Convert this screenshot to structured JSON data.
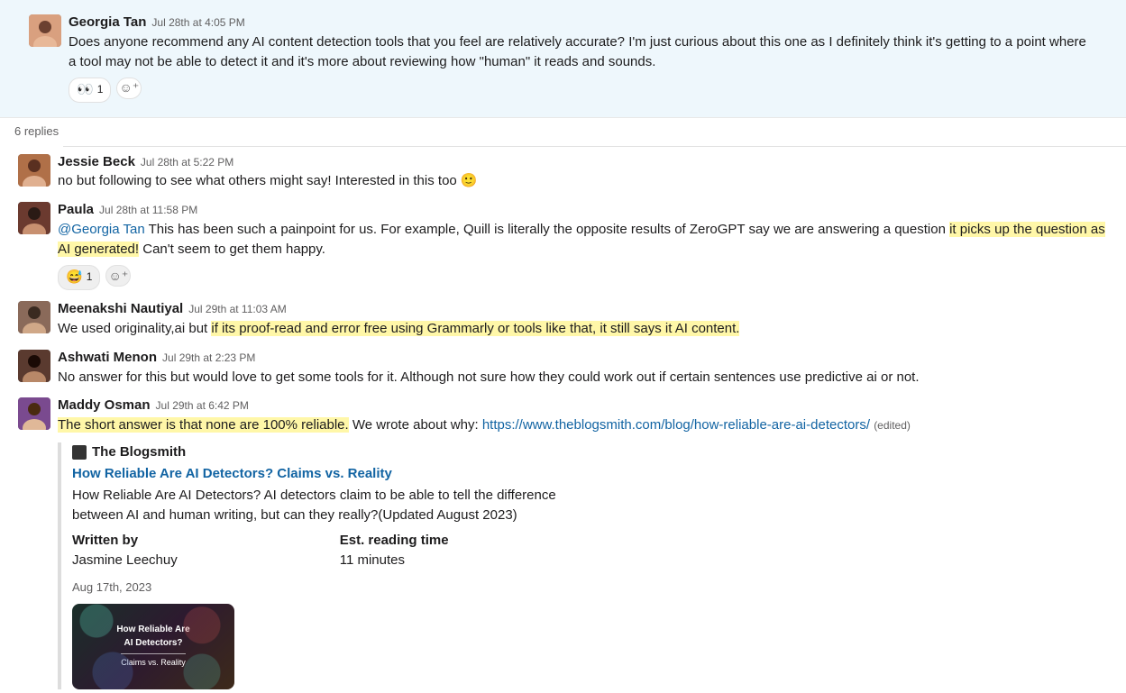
{
  "root": {
    "author": "Georgia Tan",
    "timestamp": "Jul 28th at 4:05 PM",
    "text": "Does anyone recommend any AI content detection tools that you feel are relatively accurate? I'm just curious about this one as I definitely think it's getting to a point where a tool may not be able to detect it and it's more about reviewing how \"human\" it reads and sounds.",
    "reactions": [
      {
        "emoji": "👀",
        "count": "1"
      }
    ],
    "avatar_bg": "#d9a07f"
  },
  "thread": {
    "replies_label": "6 replies"
  },
  "replies": [
    {
      "author": "Jessie Beck",
      "timestamp": "Jul 28th at 5:22 PM",
      "avatar_bg": "#b07048",
      "segments": [
        {
          "text": "no but following to see what others might say! Interested in this too "
        },
        {
          "text": "🙂",
          "emoji": true
        }
      ]
    },
    {
      "author": "Paula",
      "timestamp": "Jul 28th at 11:58 PM",
      "avatar_bg": "#6b3a2f",
      "segments": [
        {
          "text": "@Georgia Tan",
          "mention": true
        },
        {
          "text": " This has been such a painpoint for us. For example, Quill is literally the opposite results of ZeroGPT say we are answering a question "
        },
        {
          "text": "it picks up the question as AI generated!",
          "highlight": true
        },
        {
          "text": " Can't seem to get them happy."
        }
      ],
      "reactions": [
        {
          "emoji": "😅",
          "count": "1"
        }
      ]
    },
    {
      "author": "Meenakshi Nautiyal",
      "timestamp": "Jul 29th at 11:03 AM",
      "avatar_bg": "#8a6a5a",
      "segments": [
        {
          "text": "We used originality,ai but "
        },
        {
          "text": "if its proof-read and error free using Grammarly or tools like that, it still says it AI content.",
          "highlight": true
        }
      ]
    },
    {
      "author": "Ashwati Menon",
      "timestamp": "Jul 29th at 2:23 PM",
      "avatar_bg": "#5a3a2f",
      "segments": [
        {
          "text": "No answer for this but would love to get some tools for it. Although not sure how they could work out if certain sentences use predictive ai or not."
        }
      ]
    },
    {
      "author": "Maddy Osman",
      "timestamp": "Jul 29th at 6:42 PM",
      "avatar_bg": "#7a4a8f",
      "edited": "(edited)",
      "segments": [
        {
          "text": "The short answer is that none are 100% reliable.",
          "highlight": true
        },
        {
          "text": " We wrote about why: "
        },
        {
          "text": "https://www.theblogsmith.com/blog/how-reliable-are-ai-detectors/",
          "link": true
        }
      ],
      "unfurl": {
        "site": "The Blogsmith",
        "title": "How Reliable Are AI Detectors? Claims vs. Reality",
        "description": "How Reliable Are AI Detectors? AI detectors claim to be able to tell the difference between AI and human writing, but can they really?(Updated August 2023)",
        "written_by_label": "Written by",
        "written_by_value": "Jasmine Leechuy",
        "reading_time_label": "Est. reading time",
        "reading_time_value": "11 minutes",
        "date": "Aug 17th, 2023",
        "thumb_line1": "How Reliable Are",
        "thumb_line2": "AI Detectors?",
        "thumb_line3": "Claims vs. Reality"
      }
    }
  ],
  "icons": {
    "add_reaction_glyph": "☺⁺"
  }
}
